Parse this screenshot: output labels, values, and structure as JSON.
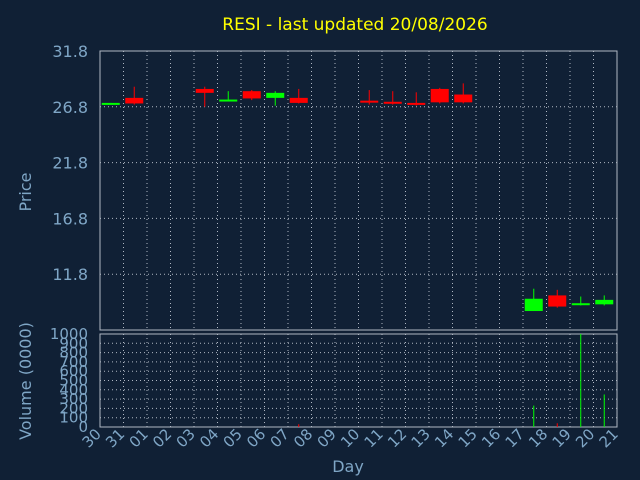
{
  "chart_data": {
    "type": "candlestick",
    "title": "RESI - last updated 20/08/2026",
    "price_panel": {
      "ylabel": "Price",
      "ylim": [
        6.8,
        31.8
      ],
      "yticks": [
        11.8,
        16.8,
        21.8,
        26.8,
        31.8
      ],
      "ytick_labels": [
        "11.8",
        "16.8",
        "21.8",
        "26.8",
        "31.8"
      ]
    },
    "volume_panel": {
      "ylabel": "Volume (0000)",
      "ylim": [
        0,
        1000
      ],
      "yticks": [
        0,
        100,
        200,
        300,
        400,
        500,
        600,
        700,
        800,
        900,
        1000
      ],
      "ytick_labels": [
        "0",
        "100",
        "200",
        "300",
        "400",
        "500",
        "600",
        "700",
        "800",
        "900",
        "1000"
      ]
    },
    "xlabel": "Day",
    "x_tick_labels": [
      "30",
      "31",
      "01",
      "02",
      "03",
      "04",
      "05",
      "06",
      "07",
      "08",
      "09",
      "10",
      "11",
      "12",
      "13",
      "14",
      "15",
      "16",
      "17",
      "18",
      "19",
      "20",
      "21"
    ],
    "candles": [
      {
        "day": "30",
        "open": 27.0,
        "close": 27.15,
        "high": 27.15,
        "low": 27.0
      },
      {
        "day": "31",
        "open": 27.6,
        "close": 27.1,
        "high": 28.6,
        "low": 27.0
      },
      {
        "day": "03",
        "open": 28.4,
        "close": 28.05,
        "high": 28.6,
        "low": 26.8
      },
      {
        "day": "04",
        "open": 27.3,
        "close": 27.45,
        "high": 28.2,
        "low": 27.3
      },
      {
        "day": "05",
        "open": 28.2,
        "close": 27.55,
        "high": 28.3,
        "low": 27.4
      },
      {
        "day": "06",
        "open": 27.6,
        "close": 28.05,
        "high": 28.2,
        "low": 26.9
      },
      {
        "day": "07",
        "open": 27.6,
        "close": 27.15,
        "high": 28.4,
        "low": 27.1
      },
      {
        "day": "10",
        "open": 27.35,
        "close": 27.25,
        "high": 28.3,
        "low": 27.0
      },
      {
        "day": "11",
        "open": 27.25,
        "close": 27.1,
        "high": 28.2,
        "low": 27.0
      },
      {
        "day": "12",
        "open": 27.15,
        "close": 27.0,
        "high": 28.1,
        "low": 26.9
      },
      {
        "day": "13",
        "open": 28.4,
        "close": 27.2,
        "high": 28.5,
        "low": 27.1
      },
      {
        "day": "14",
        "open": 27.9,
        "close": 27.2,
        "high": 28.9,
        "low": 27.1
      },
      {
        "day": "17",
        "open": 8.5,
        "close": 9.6,
        "high": 10.5,
        "low": 8.5
      },
      {
        "day": "18",
        "open": 9.9,
        "close": 8.9,
        "high": 10.4,
        "low": 8.8
      },
      {
        "day": "19",
        "open": 9.05,
        "close": 9.2,
        "high": 9.8,
        "low": 9.0
      },
      {
        "day": "20",
        "open": 9.1,
        "close": 9.5,
        "high": 9.9,
        "low": 9.0
      }
    ],
    "volumes": [
      {
        "day": "07",
        "value": 30
      },
      {
        "day": "17",
        "value": 230
      },
      {
        "day": "18",
        "value": 40
      },
      {
        "day": "19",
        "value": 1000
      },
      {
        "day": "20",
        "value": 350
      }
    ],
    "grid": true,
    "colors": {
      "background": "#102035",
      "up": "#00ff00",
      "down": "#ff0000",
      "grid": "#b0b8c4",
      "title": "#ffff00",
      "axis_text": "#7fa6c6"
    }
  }
}
